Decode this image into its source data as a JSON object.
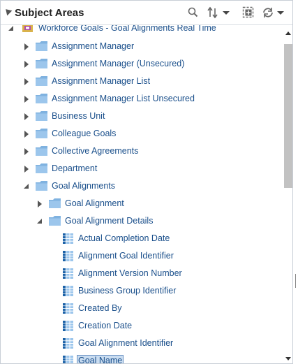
{
  "header": {
    "title": "Subject Areas"
  },
  "tree": {
    "root": {
      "label": "Workforce Goals - Goal Alignments Real Time",
      "expanded": true
    },
    "rows": [
      {
        "label": "Assignment Manager",
        "depth": 1,
        "type": "folder",
        "state": "collapsed"
      },
      {
        "label": "Assignment Manager (Unsecured)",
        "depth": 1,
        "type": "folder",
        "state": "collapsed"
      },
      {
        "label": "Assignment Manager List",
        "depth": 1,
        "type": "folder",
        "state": "collapsed"
      },
      {
        "label": "Assignment Manager List Unsecured",
        "depth": 1,
        "type": "folder",
        "state": "collapsed"
      },
      {
        "label": "Business Unit",
        "depth": 1,
        "type": "folder",
        "state": "collapsed"
      },
      {
        "label": "Colleague Goals",
        "depth": 1,
        "type": "folder",
        "state": "collapsed"
      },
      {
        "label": "Collective Agreements",
        "depth": 1,
        "type": "folder",
        "state": "collapsed"
      },
      {
        "label": "Department",
        "depth": 1,
        "type": "folder",
        "state": "collapsed"
      },
      {
        "label": "Goal Alignments",
        "depth": 1,
        "type": "folder",
        "state": "expanded"
      },
      {
        "label": "Goal Alignment",
        "depth": 2,
        "type": "folder",
        "state": "collapsed"
      },
      {
        "label": "Goal Alignment Details",
        "depth": 2,
        "type": "folder",
        "state": "expanded"
      },
      {
        "label": "Actual Completion Date",
        "depth": 3,
        "type": "column"
      },
      {
        "label": "Alignment Goal Identifier",
        "depth": 3,
        "type": "column"
      },
      {
        "label": "Alignment Version Number",
        "depth": 3,
        "type": "column"
      },
      {
        "label": "Business Group Identifier",
        "depth": 3,
        "type": "column"
      },
      {
        "label": "Created By",
        "depth": 3,
        "type": "column"
      },
      {
        "label": "Creation Date",
        "depth": 3,
        "type": "column"
      },
      {
        "label": "Goal Alignment Identifier",
        "depth": 3,
        "type": "column"
      },
      {
        "label": "Goal Name",
        "depth": 3,
        "type": "column",
        "selected": true
      }
    ]
  },
  "colors": {
    "link": "#1a4f8b",
    "folder": "#7fb2e0",
    "selection": "#c9dcf0"
  },
  "icons": {
    "search": "search-icon",
    "sort": "sort-icon",
    "add": "add-to-canvas-icon",
    "refresh": "refresh-icon"
  }
}
